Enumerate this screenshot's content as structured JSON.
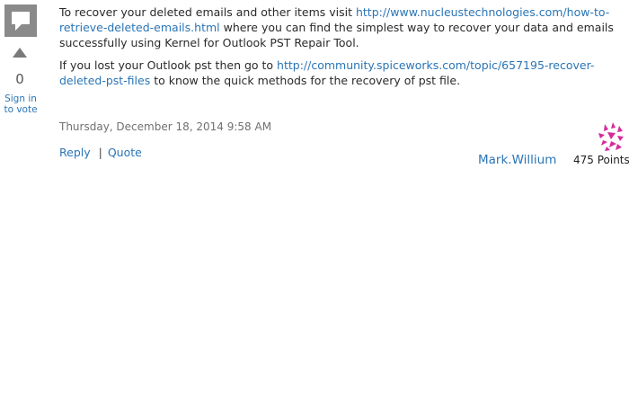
{
  "vote": {
    "count": "0",
    "sign_in_line1": "Sign in",
    "sign_in_line2": "to vote"
  },
  "post": {
    "p1_text_a": "To recover your deleted emails and other items visit ",
    "p1_link": "http://www.nucleustechnologies.com/how-to-retrieve-deleted-emails.html",
    "p1_text_b": " where you can find the simplest way to recover your data and emails successfully using Kernel for Outlook PST Repair Tool.",
    "p2_text_a": "If you lost your Outlook pst then go to ",
    "p2_link": "http://community.spiceworks.com/topic/657195-recover-deleted-pst-files",
    "p2_text_b": " to know the quick methods for the recovery of pst file.",
    "timestamp": "Thursday, December 18, 2014 9:58 AM",
    "reply_label": "Reply",
    "separator": "|",
    "quote_label": "Quote"
  },
  "author": {
    "name": "Mark.Willium",
    "points": "475 Points",
    "avatar_color": "#d62a9c"
  },
  "colors": {
    "link": "#2a75b6",
    "icon_gray": "#8a8a8a"
  }
}
